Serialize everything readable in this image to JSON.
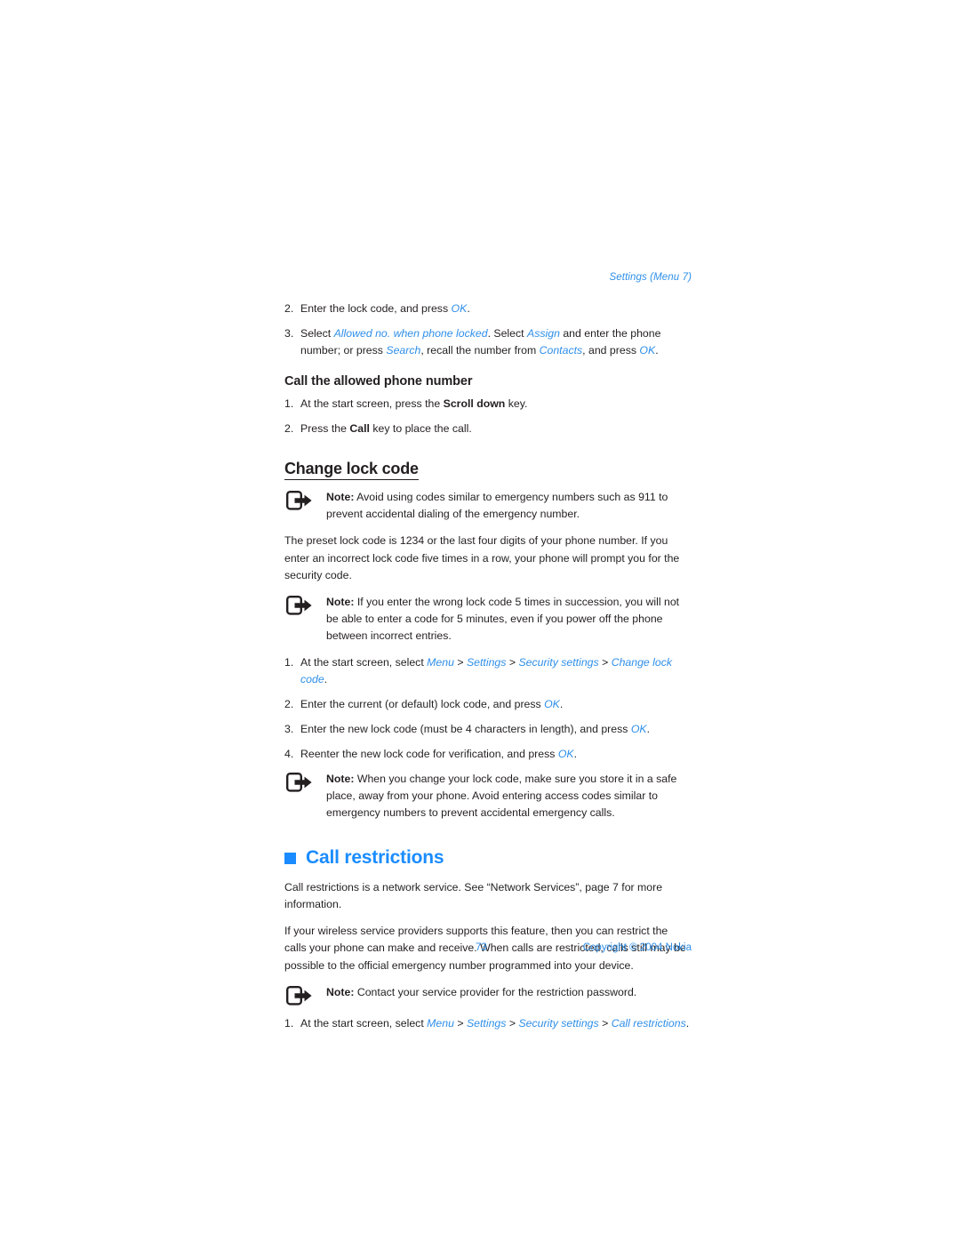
{
  "header": {
    "running_head": "Settings (Menu 7)"
  },
  "colors": {
    "link_blue": "#2f8fe8",
    "accent_blue": "#1a8cff",
    "body_black": "#231f20"
  },
  "sections": {
    "allowed_number_steps": [
      {
        "num": "2.",
        "html": "Enter the lock code, and press <i class=\"lnk\">OK</i>."
      },
      {
        "num": "3.",
        "html": "Select <i class=\"lnk\">Allowed no. when phone locked</i>. Select <i class=\"lnk\">Assign</i> and enter the phone number; or press <i class=\"lnk\">Search</i>, recall the number from <i class=\"lnk\">Contacts</i>, and press <i class=\"lnk\">OK</i>."
      }
    ],
    "call_allowed": {
      "heading": "Call the allowed phone number",
      "steps": [
        {
          "num": "1.",
          "html": "At the start screen, press the <b class=\"kw\">Scroll down</b> key."
        },
        {
          "num": "2.",
          "html": "Press the <b class=\"kw\">Call</b> key to place the call."
        }
      ]
    },
    "change_lock_code": {
      "heading": "Change lock code",
      "note_1": {
        "label": "Note:",
        "text": " Avoid using codes similar to emergency numbers such as 911 to prevent accidental dialing of the emergency number."
      },
      "paragraph_1": "The preset lock code is 1234 or the last four digits of your phone number. If you enter an incorrect lock code five times in a row, your phone will prompt you for the security code.",
      "note_2": {
        "label": "Note:",
        "text": " If you enter the wrong lock code 5 times in succession, you will not be able to enter a code for 5 minutes, even if you power off the phone between incorrect entries."
      },
      "steps": [
        {
          "num": "1.",
          "html": "At the start screen, select <i class=\"lnk\">Menu</i> <span class=\"gt\">&gt;</span> <i class=\"lnk\">Settings</i> <span class=\"gt\">&gt;</span> <i class=\"lnk\">Security settings</i> <span class=\"gt\">&gt;</span> <i class=\"lnk\">Change lock code</i>."
        },
        {
          "num": "2.",
          "html": "Enter the current (or default) lock code, and press <i class=\"lnk\">OK</i>."
        },
        {
          "num": "3.",
          "html": "Enter the new lock code (must be 4 characters in length), and press <i class=\"lnk\">OK</i>."
        },
        {
          "num": "4.",
          "html": "Reenter the new lock code for verification, and press <i class=\"lnk\">OK</i>."
        }
      ],
      "note_3": {
        "label": "Note:",
        "text": " When you change your lock code, make sure you store it in a safe place, away from your phone. Avoid entering access codes similar to emergency numbers to prevent accidental emergency calls."
      }
    },
    "call_restrictions": {
      "heading": "Call restrictions",
      "bullet_icon": "square-bullet-icon",
      "paragraph_1": "Call restrictions is a network service. See “Network Services”, page 7 for more information.",
      "paragraph_2": "If your wireless service providers supports this feature, then you can restrict the calls your phone can make and receive. When calls are restricted, calls still may be possible to the official emergency number programmed into your device.",
      "note_1": {
        "label": "Note:",
        "text": " Contact your service provider for the restriction password."
      },
      "steps": [
        {
          "num": "1.",
          "html": "At the start screen, select <i class=\"lnk\">Menu</i> <span class=\"gt\">&gt;</span> <i class=\"lnk\">Settings</i> <span class=\"gt\">&gt;</span> <i class=\"lnk\">Security settings</i> <span class=\"gt\">&gt;</span> <i class=\"lnk\">Call restrictions</i>."
        }
      ]
    }
  },
  "footer": {
    "page_number": "73",
    "copyright": "Copyright © 2004 Nokia"
  },
  "icons": {
    "note": "note-arrow-icon"
  }
}
